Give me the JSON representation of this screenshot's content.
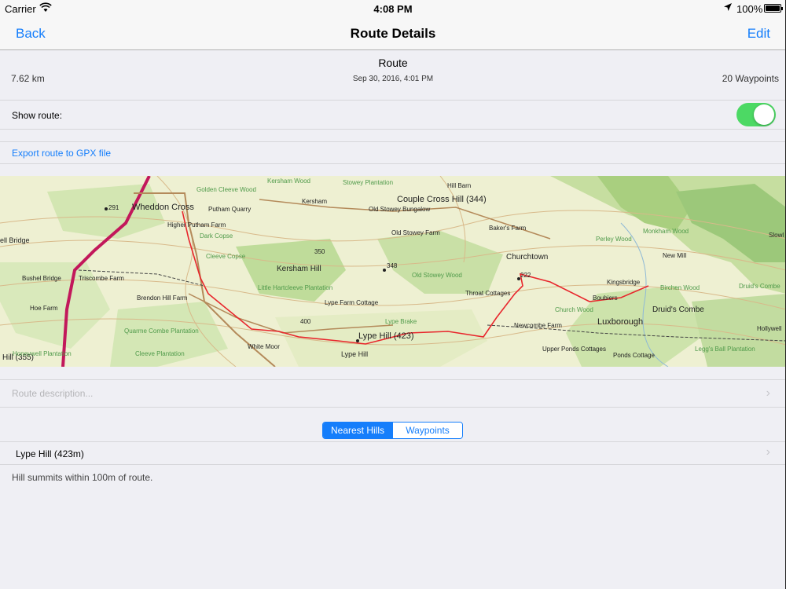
{
  "status_bar": {
    "carrier": "Carrier",
    "time": "4:08 PM",
    "battery": "100%",
    "wifi_icon": "wifi-icon",
    "location_icon": "location-arrow-icon"
  },
  "nav": {
    "back": "Back",
    "title": "Route Details",
    "edit": "Edit"
  },
  "route": {
    "name": "Route",
    "distance": "7.62 km",
    "date": "Sep 30, 2016, 4:01 PM",
    "waypoints": "20 Waypoints"
  },
  "show_route": {
    "label": "Show route:",
    "enabled": true
  },
  "export": {
    "label": "Export route to GPX file"
  },
  "map": {
    "route_color": "#e8262c",
    "road_color": "#c2185b",
    "labels": {
      "wheddon": "Wheddon Cross",
      "couple": "Couple Cross Hill (344)",
      "churchtown": "Churchtown",
      "kersham_hill": "Kersham Hill",
      "lype_hill_big": "Lype Hill (423)",
      "lype_hill": "Lype Hill",
      "luxborough": "Luxborough",
      "druids": "Druid's Combe",
      "bridge": "ell Bridge",
      "bushel": "Bushel Bridge",
      "triscombe": "Triscombe Farm",
      "brendon": "Brendon Hill Farm",
      "hoe": "Hoe Farm",
      "white_moor": "White Moor",
      "old_stowey": "Old Stowey Farm",
      "bakers": "Baker's Farm",
      "throat": "Throat Cottages",
      "newcombe": "Newcombe Farm",
      "upper_ponds": "Upper Ponds Cottages",
      "ponds": "Ponds Cottage",
      "kingsbridge": "Kingsbridge",
      "boubiers": "Boubiers",
      "lype_farm": "Lype Farm Cottage",
      "hill_barn": "Hill Barn",
      "kersham": "Kersham",
      "old_stowey_bungalow": "Old Stowey Bungalow",
      "putham": "Putham Quarry",
      "higher_putham": "Higher Putham Farm",
      "hill_355": "Hill (355)",
      "new_mill": "New Mill",
      "hollywell": "Hollywell",
      "n291": "291",
      "n348": "348",
      "n350": "350",
      "n400": "400",
      "n222": "222",
      "golden_cleeve": "Golden Cleeve Wood",
      "kersham_wood": "Kersham Wood",
      "stowey_plantation": "Stowey Plantation",
      "dark_copse": "Dark Copse",
      "cleeve_copse": "Cleeve Copse",
      "little_hartcleeve": "Little Hartcleeve Plantation",
      "old_stowey_wood": "Old Stowey Wood",
      "lype_brake": "Lype Brake",
      "quarme": "Quarme Combe Plantation",
      "honeywell": "Honeywell Plantation",
      "cleeve_plantation": "Cleeve Plantation",
      "church_wood": "Church Wood",
      "perley": "Perley Wood",
      "monkham": "Monkham Wood",
      "birchen": "Birchen Wood",
      "leggs": "Legg's Ball Plantation",
      "druids_combe_wood": "Druid's Combe",
      "slowley": "Slowl"
    }
  },
  "description": {
    "placeholder": "Route description..."
  },
  "segments": {
    "nearest_hills": "Nearest Hills",
    "waypoints": "Waypoints",
    "selected": "Nearest Hills"
  },
  "hills": [
    {
      "name": "Lype Hill (423m)"
    }
  ],
  "note": "Hill summits within 100m of route."
}
